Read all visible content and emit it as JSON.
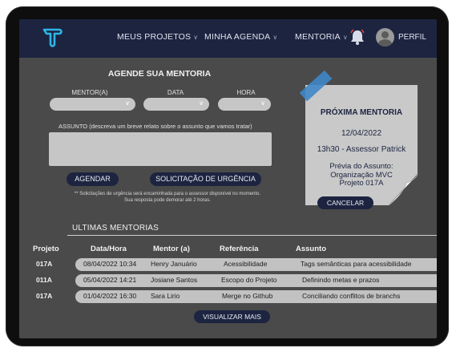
{
  "nav": {
    "items": [
      {
        "label": "MEUS PROJETOS"
      },
      {
        "label": "MINHA AGENDA"
      },
      {
        "label": "MENTORIA"
      }
    ],
    "profile_label": "PERFIL"
  },
  "schedule": {
    "title": "AGENDE SUA MENTORIA",
    "mentor_label": "MENTOR(A)",
    "date_label": "DATA",
    "time_label": "HORA",
    "subject_label": "ASSUNTO (descreva um breve relato sobre o assunto que vamos tratar)",
    "schedule_button": "AGENDAR",
    "urgent_button": "SOLICITAÇÃO DE URGÊNCIA",
    "note_line1": "** Solicitações de urgência será encaminhada para o assessor disponível no momento.",
    "note_line2": "Sua resposta pode demorar até 2 horas."
  },
  "next": {
    "title": "PRÓXIMA MENTORIA",
    "date": "12/04/2022",
    "time_advisor": "13h30 - Assessor Patrick",
    "preview": "Prévia do Assunto: Organização MVC Projeto 017A",
    "cancel_button": "CANCELAR"
  },
  "recent": {
    "title": "ULTIMAS MENTORIAS",
    "headers": [
      "Projeto",
      "Data/Hora",
      "Mentor (a)",
      "Referência",
      "Assunto"
    ],
    "rows": [
      {
        "project": "017A",
        "datetime": "08/04/2022 10:34",
        "mentor": "Henry Januário",
        "reference": "Acessibilidade",
        "subject": "Tags semânticas para acessibilidade"
      },
      {
        "project": "011A",
        "datetime": "05/04/2022 14:21",
        "mentor": "Josiane Santos",
        "reference": "Escopo do Projeto",
        "subject": "Definindo metas e prazos"
      },
      {
        "project": "017A",
        "datetime": "01/04/2022 16:30",
        "mentor": "Sara Lirio",
        "reference": "Merge no Github",
        "subject": "Conciliando conflitos de branchs"
      }
    ],
    "more_button": "VISUALIZAR MAIS"
  },
  "colors": {
    "topbar": "#1c2440",
    "background": "#4a4a4a",
    "accent": "#2fb5e8",
    "notification": "#e04040"
  }
}
